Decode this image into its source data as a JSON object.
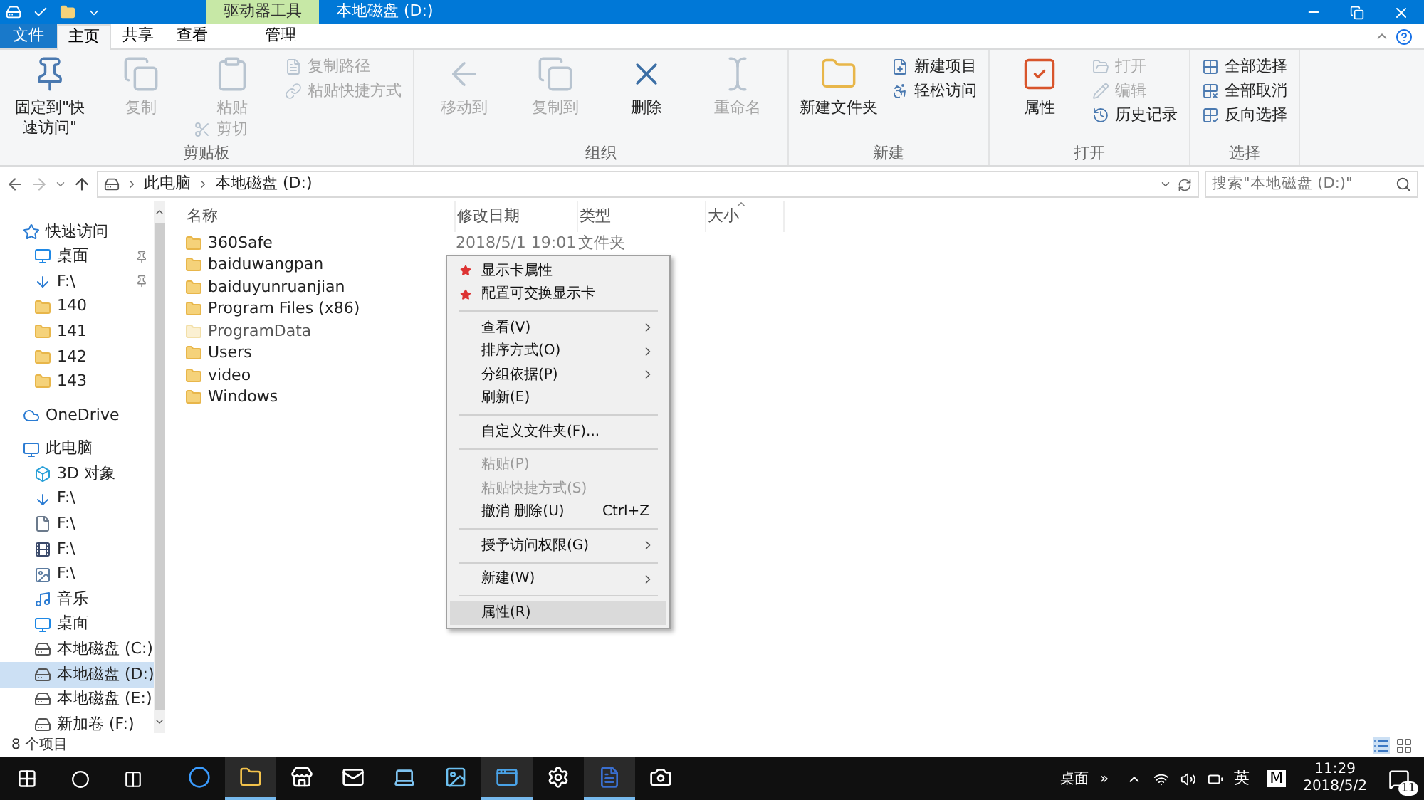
{
  "title_bar": {
    "context_tab": "驱动器工具",
    "title": "本地磁盘 (D:)"
  },
  "tabs": [
    {
      "label": "文件",
      "kind": "file",
      "selected": false
    },
    {
      "label": "主页",
      "kind": "tab",
      "selected": true
    },
    {
      "label": "共享",
      "kind": "tab",
      "selected": false
    },
    {
      "label": "查看",
      "kind": "tab",
      "selected": false
    },
    {
      "label": "管理",
      "kind": "context",
      "selected": false
    }
  ],
  "ribbon": [
    {
      "name": "剪贴板",
      "items": [
        {
          "kind": "large",
          "label": "固定到\"快速访问\"",
          "disabled": false
        },
        {
          "kind": "large",
          "label": "复制",
          "disabled": true
        },
        {
          "kind": "stack",
          "children": [
            {
              "kind": "large",
              "label": "粘贴",
              "disabled": true
            },
            {
              "kind": "small",
              "label": "剪切",
              "disabled": true
            }
          ]
        },
        {
          "kind": "column",
          "children": [
            {
              "kind": "small",
              "label": "复制路径",
              "disabled": true
            },
            {
              "kind": "small",
              "label": "粘贴快捷方式",
              "disabled": true
            }
          ]
        }
      ]
    },
    {
      "name": "组织",
      "items": [
        {
          "kind": "large",
          "label": "移动到",
          "disabled": true
        },
        {
          "kind": "large",
          "label": "复制到",
          "disabled": true
        },
        {
          "kind": "large",
          "label": "删除",
          "disabled": false
        },
        {
          "kind": "large",
          "label": "重命名",
          "disabled": true
        }
      ]
    },
    {
      "name": "新建",
      "items": [
        {
          "kind": "large",
          "label": "新建文件夹",
          "disabled": false
        },
        {
          "kind": "column",
          "children": [
            {
              "kind": "small",
              "label": "新建项目",
              "disabled": false
            },
            {
              "kind": "small",
              "label": "轻松访问",
              "disabled": false
            }
          ]
        }
      ]
    },
    {
      "name": "打开",
      "items": [
        {
          "kind": "large",
          "label": "属性",
          "disabled": false
        },
        {
          "kind": "column",
          "children": [
            {
              "kind": "small",
              "label": "打开",
              "disabled": true
            },
            {
              "kind": "small",
              "label": "编辑",
              "disabled": true
            },
            {
              "kind": "small",
              "label": "历史记录",
              "disabled": false
            }
          ]
        }
      ]
    },
    {
      "name": "选择",
      "items": [
        {
          "kind": "column",
          "children": [
            {
              "kind": "small",
              "label": "全部选择",
              "disabled": false
            },
            {
              "kind": "small",
              "label": "全部取消",
              "disabled": false
            },
            {
              "kind": "small",
              "label": "反向选择",
              "disabled": false
            }
          ]
        }
      ]
    }
  ],
  "address": {
    "path": [
      "此电脑",
      "本地磁盘 (D:)"
    ],
    "search_placeholder": "搜索\"本地磁盘 (D:)\""
  },
  "sidebar": [
    {
      "label": "快速访问",
      "kind": "star",
      "selected": false,
      "children": [
        {
          "label": "桌面",
          "kind": "desktop",
          "pinned": true,
          "selected": false
        },
        {
          "label": "F:\\",
          "kind": "download",
          "pinned": true,
          "selected": false
        },
        {
          "label": "140",
          "kind": "folder",
          "pinned": false,
          "selected": false
        },
        {
          "label": "141",
          "kind": "folder",
          "pinned": false,
          "selected": false
        },
        {
          "label": "142",
          "kind": "folder",
          "pinned": false,
          "selected": false
        },
        {
          "label": "143",
          "kind": "folder",
          "pinned": false,
          "selected": false
        }
      ]
    },
    {
      "label": "OneDrive",
      "kind": "cloud",
      "selected": false
    },
    {
      "label": "此电脑",
      "kind": "pc",
      "selected": false,
      "children": [
        {
          "label": "3D 对象",
          "kind": "cube",
          "pinned": false,
          "selected": false
        },
        {
          "label": "F:\\",
          "kind": "download",
          "pinned": false,
          "selected": false
        },
        {
          "label": "F:\\",
          "kind": "document",
          "pinned": false,
          "selected": false
        },
        {
          "label": "F:\\",
          "kind": "video",
          "pinned": false,
          "selected": false
        },
        {
          "label": "F:\\",
          "kind": "image",
          "pinned": false,
          "selected": false
        },
        {
          "label": "音乐",
          "kind": "music",
          "pinned": false,
          "selected": false
        },
        {
          "label": "桌面",
          "kind": "desktop",
          "pinned": false,
          "selected": false
        },
        {
          "label": "本地磁盘 (C:)",
          "kind": "drive",
          "pinned": false,
          "selected": false
        },
        {
          "label": "本地磁盘 (D:)",
          "kind": "drive",
          "pinned": false,
          "selected": true
        },
        {
          "label": "本地磁盘 (E:)",
          "kind": "drive",
          "pinned": false,
          "selected": false
        },
        {
          "label": "新加卷 (F:)",
          "kind": "drive",
          "pinned": false,
          "selected": false
        }
      ]
    }
  ],
  "columns": [
    "名称",
    "修改日期",
    "类型",
    "大小"
  ],
  "files": [
    {
      "name": "360Safe",
      "date": "2018/5/1 19:01",
      "type": "文件夹",
      "hidden": false
    },
    {
      "name": "baiduwangpan",
      "hidden": false
    },
    {
      "name": "baiduyunruanjian",
      "hidden": false
    },
    {
      "name": "Program Files (x86)",
      "hidden": false
    },
    {
      "name": "ProgramData",
      "hidden": true
    },
    {
      "name": "Users",
      "hidden": false
    },
    {
      "name": "video",
      "hidden": false
    },
    {
      "name": "Windows",
      "hidden": false
    }
  ],
  "context_menu": [
    {
      "kind": "item",
      "label": "显示卡属性",
      "icon": true,
      "submenu": false,
      "disabled": false,
      "selected": false
    },
    {
      "kind": "item",
      "label": "配置可交换显示卡",
      "icon": true,
      "submenu": false,
      "disabled": false,
      "selected": false
    },
    {
      "kind": "separator"
    },
    {
      "kind": "item",
      "label": "查看(V)",
      "icon": false,
      "submenu": true,
      "disabled": false,
      "selected": false
    },
    {
      "kind": "item",
      "label": "排序方式(O)",
      "icon": false,
      "submenu": true,
      "disabled": false,
      "selected": false
    },
    {
      "kind": "item",
      "label": "分组依据(P)",
      "icon": false,
      "submenu": true,
      "disabled": false,
      "selected": false
    },
    {
      "kind": "item",
      "label": "刷新(E)",
      "icon": false,
      "submenu": false,
      "disabled": false,
      "selected": false
    },
    {
      "kind": "separator"
    },
    {
      "kind": "item",
      "label": "自定义文件夹(F)...",
      "icon": false,
      "submenu": false,
      "disabled": false,
      "selected": false
    },
    {
      "kind": "separator"
    },
    {
      "kind": "item",
      "label": "粘贴(P)",
      "icon": false,
      "submenu": false,
      "disabled": true,
      "selected": false
    },
    {
      "kind": "item",
      "label": "粘贴快捷方式(S)",
      "icon": false,
      "submenu": false,
      "disabled": true,
      "selected": false
    },
    {
      "kind": "item",
      "label": "撤消 删除(U)",
      "shortcut": "Ctrl+Z",
      "icon": false,
      "submenu": false,
      "disabled": false,
      "selected": false
    },
    {
      "kind": "separator"
    },
    {
      "kind": "item",
      "label": "授予访问权限(G)",
      "icon": false,
      "submenu": true,
      "disabled": false,
      "selected": false
    },
    {
      "kind": "separator"
    },
    {
      "kind": "item",
      "label": "新建(W)",
      "icon": false,
      "submenu": true,
      "disabled": false,
      "selected": false
    },
    {
      "kind": "separator"
    },
    {
      "kind": "item",
      "label": "属性(R)",
      "icon": false,
      "submenu": false,
      "disabled": false,
      "selected": true
    }
  ],
  "status_bar": {
    "count": "8 个项目"
  },
  "taskbar": {
    "apps": [
      {
        "kind": "edge",
        "running": false
      },
      {
        "kind": "explorer",
        "running": true
      },
      {
        "kind": "store",
        "running": false
      },
      {
        "kind": "mail",
        "running": false
      },
      {
        "kind": "laptop",
        "running": false
      },
      {
        "kind": "photo",
        "running": false
      },
      {
        "kind": "window",
        "running": true
      },
      {
        "kind": "settings",
        "running": false
      },
      {
        "kind": "word",
        "running": true
      },
      {
        "kind": "camera",
        "running": false
      }
    ],
    "toolbar_label": "桌面",
    "chevron": "»",
    "ime": "英",
    "ime_mode": "M",
    "time": "11:29",
    "date": "2018/5/2",
    "notifications": "11"
  }
}
